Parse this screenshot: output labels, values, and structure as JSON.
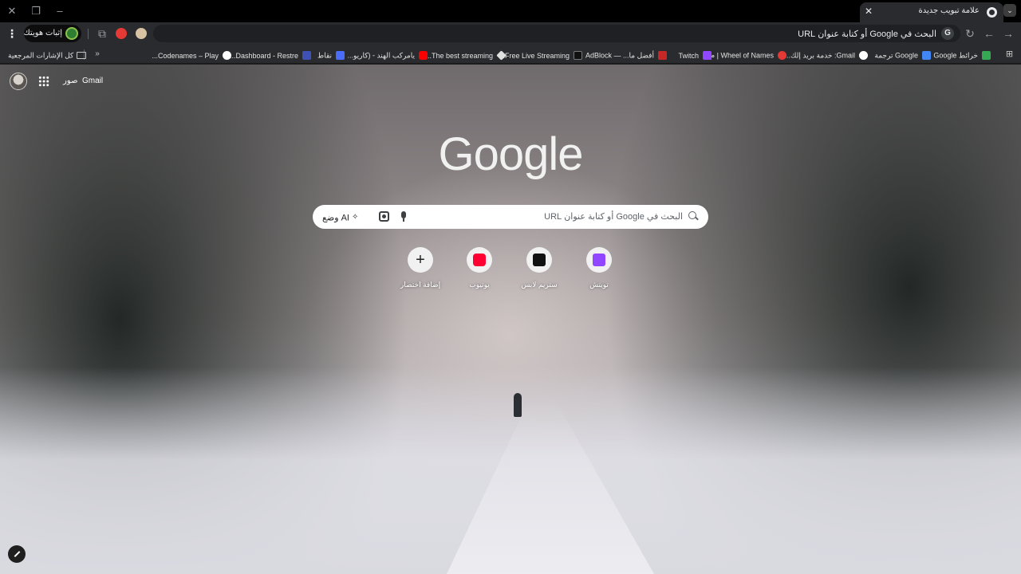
{
  "window": {
    "tab_title": "علامة تبويب جديدة",
    "close_tab_glyph": "✕",
    "new_tab_glyph": "+",
    "tab_list_glyph": "⌄",
    "minimize_glyph": "–",
    "maximize_glyph": "❐",
    "close_window_glyph": "✕"
  },
  "toolbar": {
    "omnibox_text": "البحث في Google أو كتابة عنوان URL",
    "omnibox_icon": "G",
    "profile_label": "إثبات هويتك",
    "back_glyph": "←",
    "forward_glyph": "→",
    "reload_glyph": "↻",
    "menu_glyph": "⋮",
    "extensions_glyph": "⧉"
  },
  "bookmarks": {
    "items": [
      {
        "label": "خرائط Google",
        "color": "#34a853"
      },
      {
        "label": "Google ترجمة",
        "color": "#4285f4"
      },
      {
        "label": "Gmail: خدمة بريد إلك...",
        "color": "#ffffff"
      },
      {
        "label": "Wheel of Names | م...",
        "color": "#e53935"
      },
      {
        "label": "Twitch",
        "color": "#9146ff"
      },
      {
        "label": "أفضل ما... — AdBlock",
        "color": "#c62828"
      },
      {
        "label": "Free Live Streaming...",
        "color": "#111111"
      },
      {
        "label": "The best streaming...",
        "color": "#e0e0e0"
      },
      {
        "label": "يامركب الهند - (كاريو...",
        "color": "#ff0000"
      },
      {
        "label": "نقاط",
        "color": "#4a6cf7"
      },
      {
        "label": "Dashboard - Restre...",
        "color": "#3f51b5"
      },
      {
        "label": "Codenames – Play...",
        "color": "#ffffff"
      }
    ],
    "all_bookmarks_label": "كل الإشارات المرجعية",
    "more_glyph": "»",
    "apps_glyph": "⊞"
  },
  "ntp": {
    "gmail_label": "Gmail",
    "images_label": "صور",
    "logo_text": "Google",
    "search_placeholder": "البحث في Google أو كتابة عنوان URL",
    "ai_mode_label": "وضع AI",
    "ai_mode_glyph": "✧",
    "shortcuts": [
      {
        "name": "تويتش",
        "color": "#9146ff"
      },
      {
        "name": "ستريم لابس",
        "color": "#111111"
      },
      {
        "name": "يوتيوب",
        "color": "#ff0033"
      },
      {
        "name": "إضافة اختصار",
        "plus": "+"
      }
    ]
  }
}
